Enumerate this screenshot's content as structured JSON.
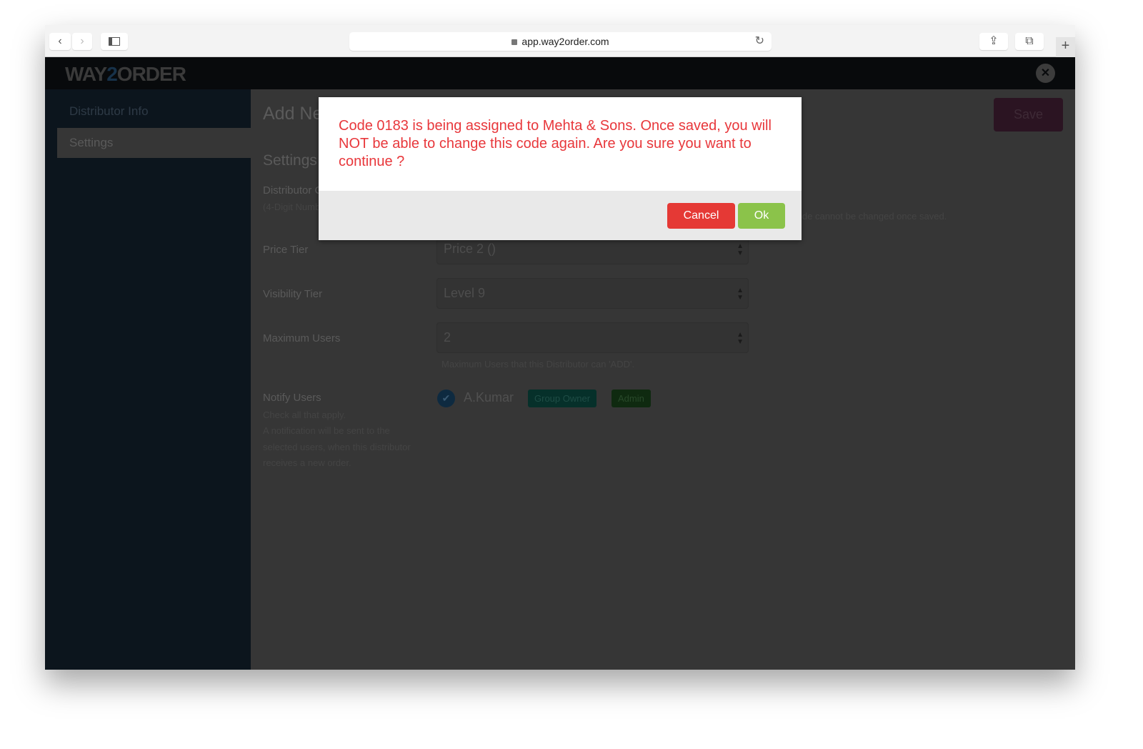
{
  "browser": {
    "url": "app.way2order.com",
    "back_icon": "‹",
    "forward_icon": "›"
  },
  "app": {
    "logo_pre": "WAY",
    "logo_mid": "2",
    "logo_post": "ORDER"
  },
  "sidebar": {
    "items": [
      {
        "label": "Distributor Info"
      },
      {
        "label": "Settings"
      }
    ]
  },
  "main": {
    "title": "Add New Distributor",
    "save_label": "Save",
    "section": "Settings",
    "distributor_code": {
      "label": "Distributor Code",
      "hint": "(4-Digit Number)",
      "note": "This code cannot be changed once saved."
    },
    "price_tier": {
      "label": "Price Tier",
      "value": "Price 2 ()"
    },
    "visibility_tier": {
      "label": "Visibility Tier",
      "value": "Level 9"
    },
    "max_users": {
      "label": "Maximum Users",
      "value": "2",
      "hint": "Maximum Users that this Distributor can 'ADD'."
    },
    "notify": {
      "label": "Notify Users",
      "hint1": "Check all that apply.",
      "hint2": "A notification will be sent to the",
      "hint3": "selected users, when this distributor",
      "hint4": "receives a new order.",
      "user": "A.Kumar",
      "checked": true,
      "badges": [
        "Group Owner",
        "Admin"
      ]
    }
  },
  "modal": {
    "message": "Code 0183 is being assigned to Mehta & Sons. Once saved, you will NOT be able to change this code again. Are you sure you want to continue ?",
    "cancel": "Cancel",
    "ok": "Ok",
    "colors": {
      "message": "#e8373b",
      "cancel": "#e53935",
      "ok": "#8bc34a"
    }
  }
}
